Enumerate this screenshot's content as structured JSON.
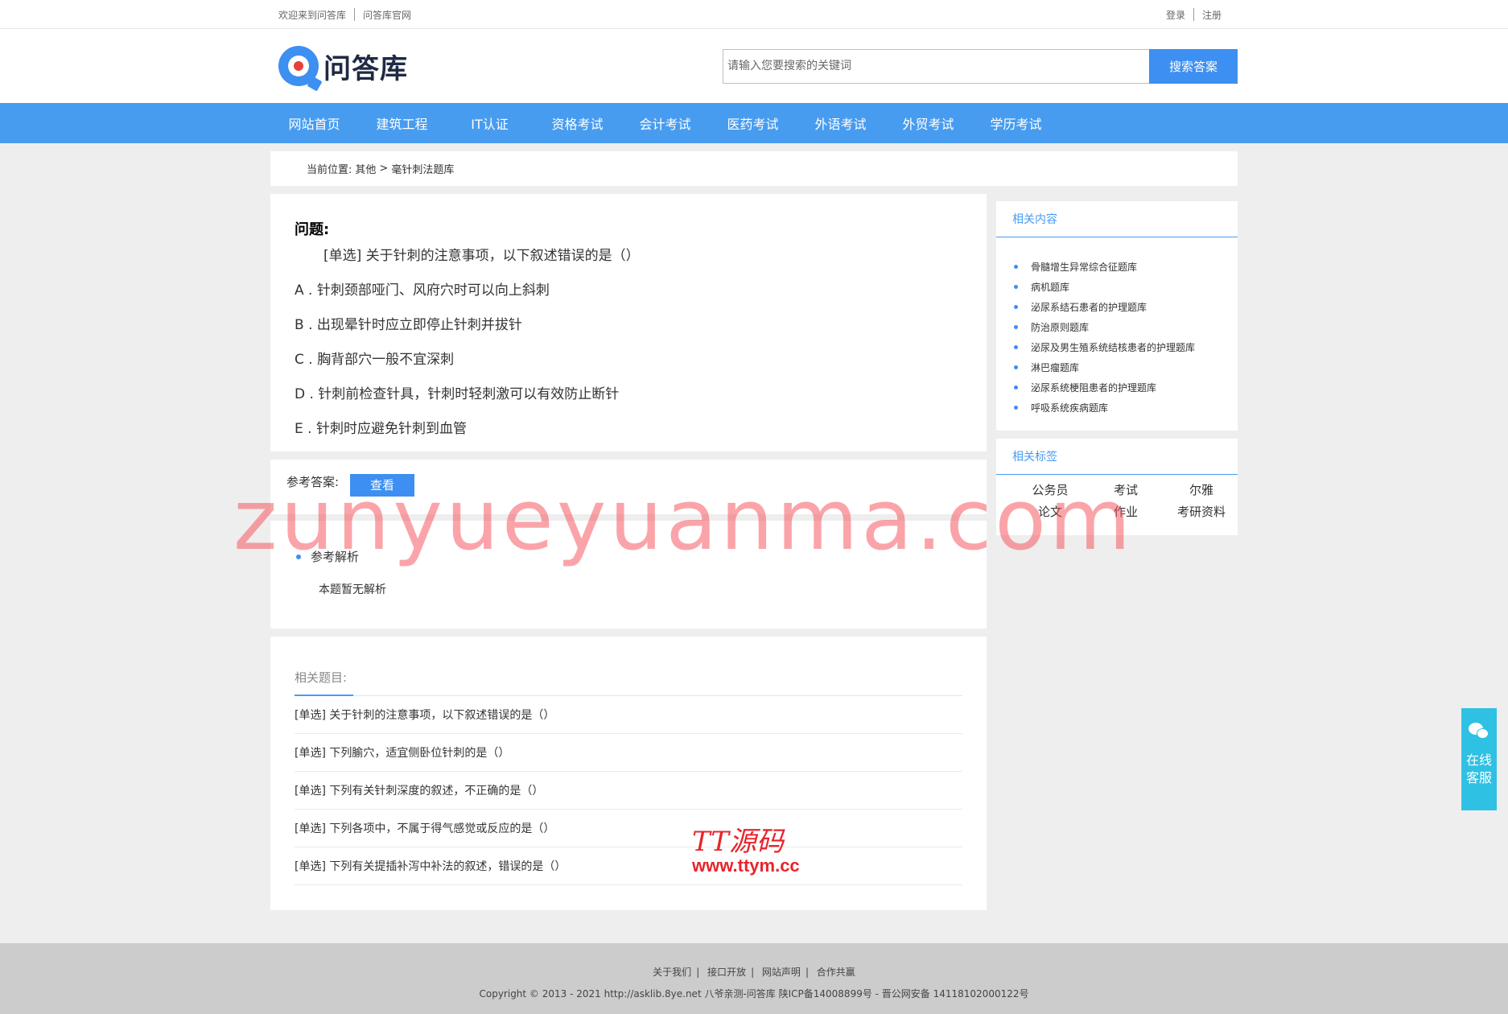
{
  "topbar": {
    "welcome": "欢迎来到问答库",
    "official": "问答库官网",
    "login": "登录",
    "register": "注册"
  },
  "header": {
    "logo_text": "问答库",
    "search_placeholder": "请输入您要搜索的关键词",
    "search_button": "搜索答案"
  },
  "nav": [
    "网站首页",
    "建筑工程",
    "IT认证",
    "资格考试",
    "会计考试",
    "医药考试",
    "外语考试",
    "外贸考试",
    "学历考试"
  ],
  "breadcrumb": {
    "label": "当前位置:",
    "parent": "其他",
    "sep": ">",
    "current": "毫针刺法题库"
  },
  "question": {
    "title": "问题:",
    "text": "[单选] 关于针刺的注意事项，以下叙述错误的是（）",
    "options": [
      "A . 针刺颈部哑门、风府穴时可以向上斜刺",
      "B . 出现晕针时应立即停止针刺并拔针",
      "C . 胸背部穴一般不宜深刺",
      "D . 针刺前检查针具，针刺时轻刺激可以有效防止断针",
      "E . 针刺时应避免针刺到血管"
    ]
  },
  "answer": {
    "label": "参考答案:",
    "view_button": "查看",
    "analysis_title": "参考解析",
    "analysis_body": "本题暂无解析"
  },
  "related_questions": {
    "title": "相关题目:",
    "items": [
      "[单选] 关于针刺的注意事项，以下叙述错误的是（）",
      "[单选] 下列腧穴，适宜侧卧位针刺的是（）",
      "[单选] 下列有关针刺深度的叙述，不正确的是（）",
      "[单选] 下列各项中，不属于得气感觉或反应的是（）",
      "[单选] 下列有关提插补泻中补法的叙述，错误的是（）"
    ]
  },
  "sidebar": {
    "related_title": "相关内容",
    "related_items": [
      "骨髓增生异常综合征题库",
      "病机题库",
      "泌尿系结石患者的护理题库",
      "防治原则题库",
      "泌尿及男生殖系统结核患者的护理题库",
      "淋巴瘤题库",
      "泌尿系统梗阻患者的护理题库",
      "呼吸系统疾病题库"
    ],
    "tags_title": "相关标签",
    "tags": [
      "公务员",
      "考试",
      "尔雅",
      "论文",
      "作业",
      "考研资料"
    ]
  },
  "footer": {
    "links": [
      "关于我们",
      "接口开放",
      "网站声明",
      "合作共赢"
    ],
    "copyright": "Copyright © 2013 - 2021 http://asklib.8ye.net  八爷亲测-问答库  陕ICP备14008899号 - 晋公网安备 14118102000122号"
  },
  "float_service": {
    "line1": "在线",
    "line2": "客服"
  },
  "watermark": {
    "main": "zunyueyuanma.com",
    "brand": "TT源码",
    "brand_url": "www.ttym.cc"
  },
  "colors": {
    "accent": "#3d8ff1",
    "nav_bg": "#479cf0",
    "service_bg": "#2fc1e4"
  }
}
